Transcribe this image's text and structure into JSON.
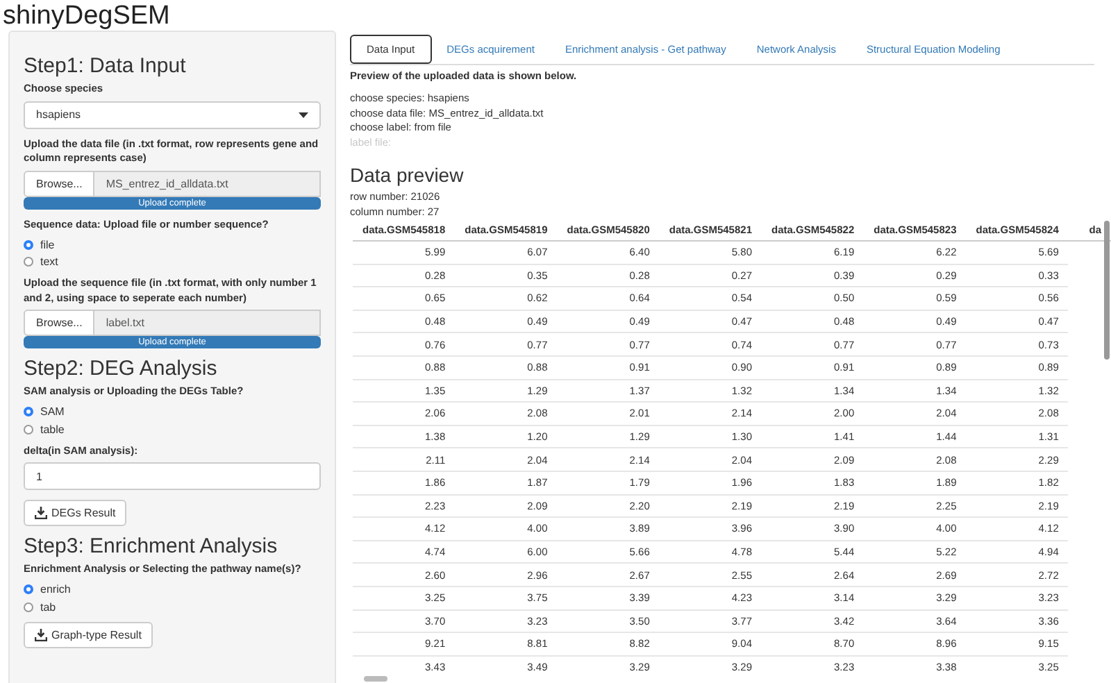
{
  "app_title": "shinyDegSEM",
  "sidebar": {
    "steps": [
      {
        "heading": "Step1: Data Input",
        "controls": [
          {
            "kind": "select",
            "label": "Choose species",
            "value": "hsapiens"
          },
          {
            "kind": "file",
            "label": "Upload the data file (in .txt format, row represents gene and column represents case)",
            "button": "Browse...",
            "value": "MS_entrez_id_alldata.txt",
            "progress": "Upload complete",
            "level": 1
          },
          {
            "kind": "radio",
            "label": "Sequence data: Upload file or number sequence?",
            "options": [
              {
                "label": "file",
                "selected": true
              },
              {
                "label": "text",
                "selected": false
              }
            ]
          },
          {
            "kind": "file",
            "label": "Upload the sequence file (in .txt format, with only number 1 and 2, using space to seperate each number)",
            "button": "Browse...",
            "value": "label.txt",
            "progress": "Upload complete",
            "level": 1
          }
        ]
      },
      {
        "heading": "Step2: DEG Analysis",
        "controls": [
          {
            "kind": "radio",
            "label": "SAM analysis or Uploading the DEGs Table?",
            "options": [
              {
                "label": "SAM",
                "selected": true
              },
              {
                "label": "table",
                "selected": false
              }
            ]
          },
          {
            "kind": "number",
            "label": "delta(in SAM analysis):",
            "value": "1"
          },
          {
            "kind": "download",
            "button": "DEGs Result"
          }
        ]
      },
      {
        "heading": "Step3: Enrichment Analysis",
        "controls": [
          {
            "kind": "radio",
            "label": "Enrichment Analysis or Selecting the pathway name(s)?",
            "options": [
              {
                "label": "enrich",
                "selected": true
              },
              {
                "label": "tab",
                "selected": false
              }
            ]
          },
          {
            "kind": "download",
            "button": "Graph-type Result"
          }
        ]
      }
    ]
  },
  "tabs": [
    {
      "label": "Data Input",
      "selected": true
    },
    {
      "label": "DEGs acquirement",
      "selected": false
    },
    {
      "label": "Enrichment analysis - Get pathway",
      "selected": false
    },
    {
      "label": "Network Analysis",
      "selected": false
    },
    {
      "label": "Structural Equation Modeling",
      "selected": false
    }
  ],
  "intro": "Preview of the uploaded data is shown below.",
  "summary": [
    {
      "text": "choose species: hsapiens",
      "disabled": false
    },
    {
      "text": "choose data file: MS_entrez_id_alldata.txt",
      "disabled": false
    },
    {
      "text": "choose label: from file",
      "disabled": false
    },
    {
      "text": "label file:",
      "disabled": true
    }
  ],
  "preview": {
    "heading": "Data preview",
    "stats": [
      "row number: 21026",
      "column number: 27"
    ],
    "table": {
      "columns": [
        "data.GSM545818",
        "data.GSM545819",
        "data.GSM545820",
        "data.GSM545821",
        "data.GSM545822",
        "data.GSM545823",
        "data.GSM545824",
        "da"
      ],
      "rows": [
        [
          "5.99",
          "6.07",
          "6.40",
          "5.80",
          "6.19",
          "6.22",
          "5.69"
        ],
        [
          "0.28",
          "0.35",
          "0.28",
          "0.27",
          "0.39",
          "0.29",
          "0.33"
        ],
        [
          "0.65",
          "0.62",
          "0.64",
          "0.54",
          "0.50",
          "0.59",
          "0.56"
        ],
        [
          "0.48",
          "0.49",
          "0.49",
          "0.47",
          "0.48",
          "0.49",
          "0.47"
        ],
        [
          "0.76",
          "0.77",
          "0.77",
          "0.74",
          "0.77",
          "0.77",
          "0.73"
        ],
        [
          "0.88",
          "0.88",
          "0.91",
          "0.90",
          "0.91",
          "0.89",
          "0.89"
        ],
        [
          "1.35",
          "1.29",
          "1.37",
          "1.32",
          "1.34",
          "1.34",
          "1.32"
        ],
        [
          "2.06",
          "2.08",
          "2.01",
          "2.14",
          "2.00",
          "2.04",
          "2.08"
        ],
        [
          "1.38",
          "1.20",
          "1.29",
          "1.30",
          "1.41",
          "1.44",
          "1.31"
        ],
        [
          "2.11",
          "2.04",
          "2.14",
          "2.04",
          "2.09",
          "2.08",
          "2.29"
        ],
        [
          "1.86",
          "1.87",
          "1.79",
          "1.96",
          "1.83",
          "1.89",
          "1.82"
        ],
        [
          "2.23",
          "2.09",
          "2.20",
          "2.19",
          "2.19",
          "2.25",
          "2.19"
        ],
        [
          "4.12",
          "4.00",
          "3.89",
          "3.96",
          "3.90",
          "4.00",
          "4.12"
        ],
        [
          "4.74",
          "6.00",
          "5.66",
          "4.78",
          "5.44",
          "5.22",
          "4.94"
        ],
        [
          "2.60",
          "2.96",
          "2.67",
          "2.55",
          "2.64",
          "2.69",
          "2.72"
        ],
        [
          "3.25",
          "3.75",
          "3.39",
          "4.23",
          "3.14",
          "3.29",
          "3.23"
        ],
        [
          "3.70",
          "3.23",
          "3.50",
          "3.77",
          "3.42",
          "3.64",
          "3.36"
        ],
        [
          "9.21",
          "8.81",
          "8.82",
          "9.04",
          "8.70",
          "8.96",
          "9.15"
        ],
        [
          "3.43",
          "3.49",
          "3.29",
          "3.29",
          "3.23",
          "3.38",
          "3.25"
        ]
      ]
    }
  }
}
